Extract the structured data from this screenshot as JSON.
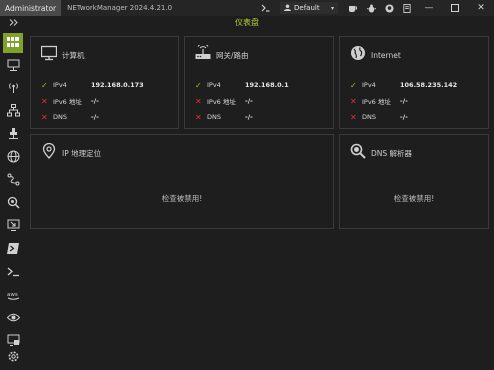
{
  "titlebar": {
    "admin_badge": "Administrator",
    "app_title": "NETworkManager 2024.4.21.0",
    "profile": "Default"
  },
  "page": {
    "title": "仪表盘"
  },
  "sidebar": {
    "items": [
      {
        "icon": "dashboard-icon",
        "active": true
      },
      {
        "icon": "monitor-network-icon"
      },
      {
        "icon": "wifi-antenna-icon"
      },
      {
        "icon": "network-topology-icon"
      },
      {
        "icon": "ethernet-port-icon"
      },
      {
        "icon": "globe-icon"
      },
      {
        "icon": "route-icon"
      },
      {
        "icon": "search-network-icon"
      },
      {
        "icon": "remote-desktop-icon"
      },
      {
        "icon": "powershell-icon"
      },
      {
        "icon": "terminal-icon"
      },
      {
        "icon": "aws-icon"
      },
      {
        "icon": "eye-icon"
      },
      {
        "icon": "remote-screen-icon"
      },
      {
        "icon": "settings-icon"
      }
    ]
  },
  "cards": {
    "computer": {
      "title": "计算机",
      "rows": [
        {
          "status": "ok",
          "label": "IPv4",
          "value": "192.168.0.173"
        },
        {
          "status": "bad",
          "label": "IPv6 地址",
          "value": "-/-"
        },
        {
          "status": "bad",
          "label": "DNS",
          "value": "-/-"
        }
      ]
    },
    "router": {
      "title": "网关/路由",
      "rows": [
        {
          "status": "ok",
          "label": "IPv4",
          "value": "192.168.0.1"
        },
        {
          "status": "bad",
          "label": "IPv6 地址",
          "value": "-/-"
        },
        {
          "status": "bad",
          "label": "DNS",
          "value": "-/-"
        }
      ]
    },
    "internet": {
      "title": "Internet",
      "rows": [
        {
          "status": "ok",
          "label": "IPv4",
          "value": "106.58.235.142"
        },
        {
          "status": "bad",
          "label": "IPv6 地址",
          "value": "-/-"
        },
        {
          "status": "bad",
          "label": "DNS",
          "value": "-/-"
        }
      ]
    },
    "geolocation": {
      "title": "IP 地理定位",
      "message": "检查被禁用!"
    },
    "dns_resolver": {
      "title": "DNS 解析器",
      "message": "检查被禁用!"
    }
  },
  "colors": {
    "accent": "#7fa22a",
    "title_accent": "#b8d432",
    "ok": "#8fbf2a",
    "bad": "#d9352c"
  }
}
